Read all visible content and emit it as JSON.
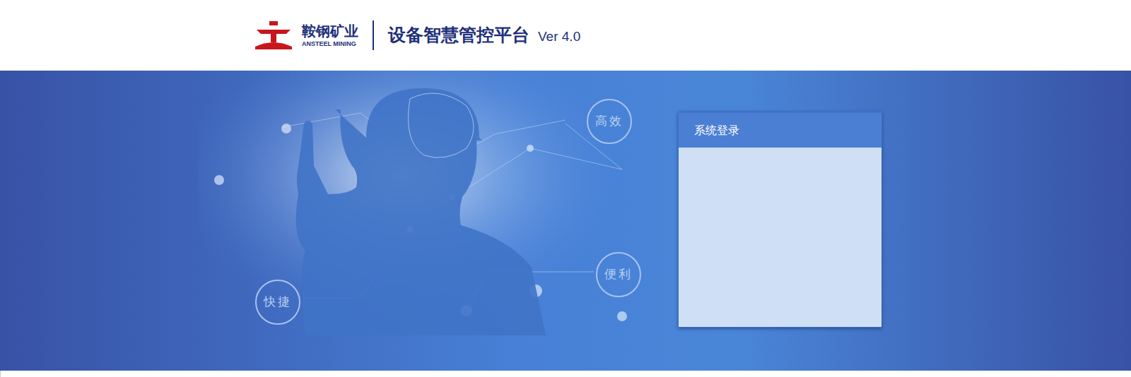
{
  "header": {
    "company": "鞍钢矿业",
    "company_en": "ANSTEEL MINING",
    "title": "设备智慧管控平台",
    "version": "Ver 4.0"
  },
  "hero": {
    "features": [
      "高效",
      "便利",
      "快捷"
    ]
  },
  "login": {
    "title": "系统登录"
  }
}
